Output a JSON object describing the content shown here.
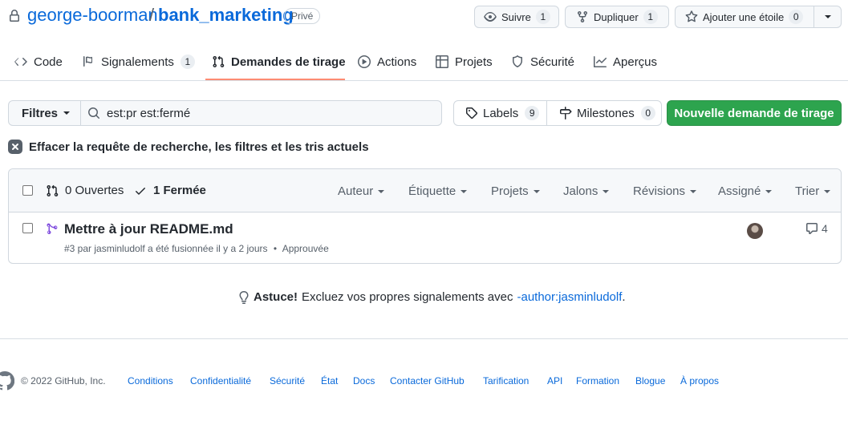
{
  "repo": {
    "owner": "george-boorman",
    "separator": "/",
    "name": "bank_marketing",
    "visibility": "Privé"
  },
  "header_actions": {
    "watch": {
      "label": "Suivre",
      "count": "1",
      "icon": "eye-icon"
    },
    "fork": {
      "label": "Dupliquer",
      "count": "1",
      "icon": "fork-icon"
    },
    "star": {
      "label": "Ajouter une étoile",
      "count": "0",
      "icon": "star-icon"
    }
  },
  "tabs": [
    {
      "label": "Code",
      "icon": "code-icon"
    },
    {
      "label": "Signalements",
      "count": "1",
      "icon": "issue-icon"
    },
    {
      "label": "Demandes de tirage",
      "icon": "pull-request-icon",
      "selected": true
    },
    {
      "label": "Actions",
      "icon": "play-icon"
    },
    {
      "label": "Projets",
      "icon": "table-icon"
    },
    {
      "label": "Sécurité",
      "icon": "shield-icon"
    },
    {
      "label": "Aperçus",
      "icon": "graph-icon"
    }
  ],
  "filter_bar": {
    "filters_label": "Filtres",
    "search_value": "est:pr est:fermé",
    "labels": {
      "label": "Labels",
      "count": "9"
    },
    "milestones": {
      "label": "Milestones",
      "count": "0"
    },
    "new_pr_label": "Nouvelle demande de tirage"
  },
  "clear_filters_label": "Effacer la requête de recherche, les filtres et les tris actuels",
  "list_header": {
    "open_label": "0 Ouvertes",
    "closed_label": "1 Fermée",
    "filters": [
      "Auteur",
      "Étiquette",
      "Projets",
      "Jalons",
      "Révisions",
      "Assigné",
      "Trier"
    ]
  },
  "pull_requests": [
    {
      "title": "Mettre à jour README.md",
      "meta": "#3 par jasminludolf a été fusionnée il y a 2 jours",
      "separator": "•",
      "review_status": "Approuvée",
      "comments": "4"
    }
  ],
  "protip": {
    "bold": "Astuce!",
    "text": "Excluez vos propres signalements avec",
    "link": "-author:jasminludolf",
    "suffix": "."
  },
  "footer": {
    "copyright": "© 2022 GitHub, Inc.",
    "links": [
      "Conditions",
      "Confidentialité",
      "Sécurité",
      "État",
      "Docs",
      "Contacter GitHub",
      "Tarification",
      "API",
      "Formation",
      "Blogue",
      "À propos"
    ]
  },
  "colors": {
    "link": "#0969da",
    "primary_button": "#2da44e",
    "tab_underline": "#fd8c73",
    "merged": "#8250df"
  }
}
